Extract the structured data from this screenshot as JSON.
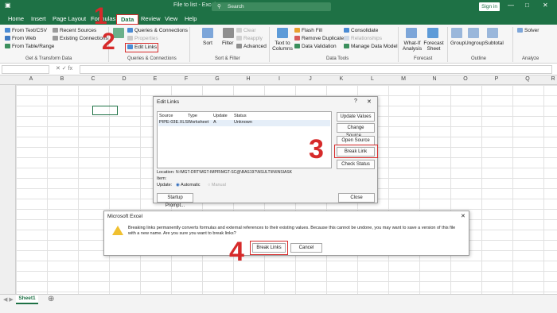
{
  "window": {
    "title": "File to list - Excel",
    "search_placeholder": "Search",
    "signin_label": "Sign in"
  },
  "tabs": [
    "Home",
    "Insert",
    "Page Layout",
    "Formulas",
    "Data",
    "Review",
    "View",
    "Help"
  ],
  "ribbon": {
    "get_data": [
      "From Text/CSV",
      "From Web",
      "From Table/Range"
    ],
    "recent": [
      "Recent Sources",
      "Existing Connections"
    ],
    "get_transform_label": "Get & Transform Data",
    "refresh_all": "Refresh All",
    "queries": [
      "Queries & Connections",
      "Properties",
      "Edit Links"
    ],
    "queries_label": "Queries & Connections",
    "sort": "Sort",
    "filter": "Filter",
    "sort_filter_side": [
      "Clear",
      "Reapply",
      "Advanced"
    ],
    "sort_filter_label": "Sort & Filter",
    "text_to_columns": "Text to Columns",
    "data_tools_col1": [
      "Flash Fill",
      "Remove Duplicates",
      "Data Validation"
    ],
    "data_tools_col2": [
      "Consolidate",
      "Relationships",
      "Manage Data Model"
    ],
    "data_tools_label": "Data Tools",
    "whatif": "What-If Analysis",
    "forecast_sheet": "Forecast Sheet",
    "forecast_label": "Forecast",
    "outline": [
      "Group",
      "Ungroup",
      "Subtotal"
    ],
    "outline_label": "Outline",
    "solver": "Solver",
    "analyze_label": "Analyze"
  },
  "columns": [
    "A",
    "B",
    "C",
    "D",
    "E",
    "F",
    "G",
    "H",
    "I",
    "J",
    "K",
    "L",
    "M",
    "N",
    "O",
    "P",
    "Q",
    "R"
  ],
  "edit_links": {
    "title": "Edit Links",
    "headers": [
      "Source",
      "Type",
      "Update",
      "Status"
    ],
    "row": [
      "PIPE-03E.XLS",
      "Worksheet",
      "A",
      "Unknown"
    ],
    "buttons": [
      "Update Values",
      "Change Source...",
      "Open Source",
      "Break Link",
      "Check Status"
    ],
    "location_label": "Location:",
    "location_value": "N:\\MGT-DRT\\MGT-IMPR\\MGT-SC@\\BAS197\\NSULT\\IN\\INSIASK",
    "item_label": "Item:",
    "update_label": "Update:",
    "automatic": "Automatic",
    "manual": "Manual",
    "startup": "Startup Prompt...",
    "close": "Close"
  },
  "confirm": {
    "title": "Microsoft Excel",
    "message": "Breaking links permanently converts formulas and external references to their existing values. Because this cannot be undone, you may want to save a version of this file with a new name. Are you sure you want to break links?",
    "break_links": "Break Links",
    "cancel": "Cancel"
  },
  "steps": [
    "1",
    "2",
    "3",
    "4"
  ],
  "sheet_tab": "Sheet1",
  "colors": {
    "excel_green": "#1e7145",
    "highlight_red": "#d62a2a"
  }
}
